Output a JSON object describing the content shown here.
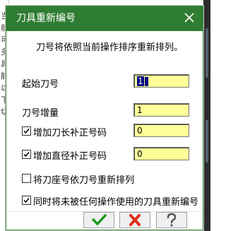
{
  "background_left_text": "当前可多具能以下切",
  "dialog": {
    "title": "刀具重新编号",
    "close_icon": "close-icon",
    "instruction": "刀号将依照当前操作排序重新排列。"
  },
  "fields": {
    "start_tool_label": "起始刀号",
    "start_tool_value": "1",
    "increment_label": "刀号增量",
    "increment_value": "1",
    "length_offset_label": "增加刀长补正号码",
    "length_offset_checked": true,
    "length_offset_value": "0",
    "diameter_offset_label": "增加直径补正号码",
    "diameter_offset_checked": true,
    "diameter_offset_value": "0",
    "by_holder_label": "将刀座号依刀号重新排列",
    "by_holder_checked": false,
    "renumber_unused_label": "同时将未被任何操作使用的刀具重新编号",
    "renumber_unused_checked": true
  },
  "buttons": {
    "ok_icon": "check-icon",
    "cancel_icon": "x-icon",
    "help_icon": "question-icon"
  },
  "colors": {
    "titlebar": "#2f7d32",
    "field_bg": "#ffff99",
    "ok": "#1a9a1a",
    "cancel": "#e0301e",
    "help": "#555555"
  }
}
